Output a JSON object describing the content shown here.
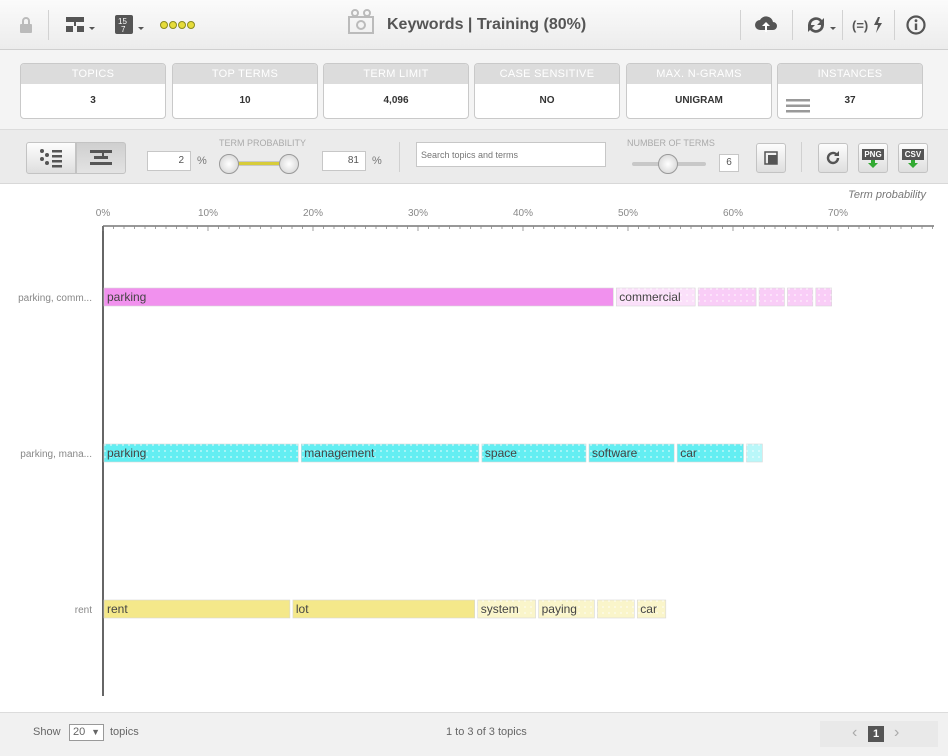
{
  "toolbar": {
    "title": "Keywords | Training (80%)",
    "icons": [
      "lock-icon",
      "tree-icon",
      "number-icon",
      "chain-icon",
      "model-icon",
      "upload-icon",
      "retrain-icon",
      "formula-icon",
      "info-icon"
    ]
  },
  "stats": [
    {
      "label": "TOPICS",
      "value": "3"
    },
    {
      "label": "TOP TERMS",
      "value": "10"
    },
    {
      "label": "TERM LIMIT",
      "value": "4,096"
    },
    {
      "label": "CASE SENSITIVE",
      "value": "NO"
    },
    {
      "label": "MAX. N-GRAMS",
      "value": "UNIGRAM"
    },
    {
      "label": "INSTANCES",
      "value": "37"
    }
  ],
  "controls": {
    "term_probability_label": "TERM PROBABILITY",
    "min_value": "2",
    "max_value": "81",
    "percent": "%",
    "search_placeholder": "Search topics and terms",
    "number_of_terms_label": "NUMBER OF TERMS",
    "number_of_terms_value": "6",
    "png_label": "PNG",
    "csv_label": "CSV"
  },
  "chart_data": {
    "type": "bar",
    "axis_title": "Term probability",
    "x_ticks": [
      "0%",
      "10%",
      "20%",
      "30%",
      "40%",
      "50%",
      "60%",
      "70%"
    ],
    "xlim": [
      0,
      0.8
    ],
    "topics": [
      {
        "label": "parking, comm...",
        "color": "#f191ee",
        "terms": [
          {
            "term": "parking",
            "value": 0.486
          },
          {
            "term": "commercial",
            "value": 0.078
          },
          {
            "term": "",
            "value": 0.058
          },
          {
            "term": "",
            "value": 0.027
          },
          {
            "term": "",
            "value": 0.027
          },
          {
            "term": "",
            "value": 0.018
          }
        ]
      },
      {
        "label": "parking, mana...",
        "color": "#63eef2",
        "terms": [
          {
            "term": "parking",
            "value": 0.186
          },
          {
            "term": "management",
            "value": 0.172
          },
          {
            "term": "space",
            "value": 0.102
          },
          {
            "term": "software",
            "value": 0.084
          },
          {
            "term": "car",
            "value": 0.066
          },
          {
            "term": "",
            "value": 0.018
          }
        ]
      },
      {
        "label": "rent",
        "color": "#f4e88a",
        "terms": [
          {
            "term": "rent",
            "value": 0.178
          },
          {
            "term": "lot",
            "value": 0.176
          },
          {
            "term": "system",
            "value": 0.058
          },
          {
            "term": "paying",
            "value": 0.056
          },
          {
            "term": "",
            "value": 0.038
          },
          {
            "term": "car",
            "value": 0.03
          }
        ]
      }
    ]
  },
  "footer": {
    "show_label": "Show",
    "per_page": "20",
    "topics_label": "topics",
    "range_text": "1 to 3 of 3 topics",
    "page": "1"
  }
}
